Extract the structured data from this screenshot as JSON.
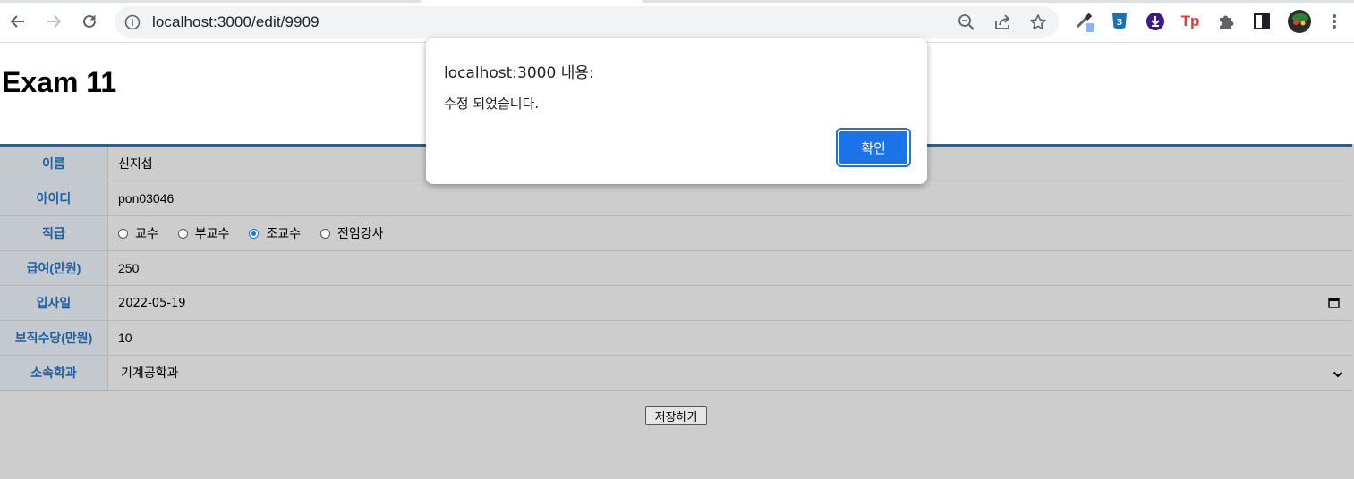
{
  "browser": {
    "url": "localhost:3000/edit/9909",
    "extensions": [
      {
        "name": "eyedropper-extension-icon",
        "color": "#5f6368"
      },
      {
        "name": "css-extension-icon",
        "color": "#1572b6"
      },
      {
        "name": "download-extension-icon",
        "color": "#3d1a8f"
      },
      {
        "name": "tp-extension-icon",
        "label": "Tp",
        "color": "#e53935"
      },
      {
        "name": "puzzle-extensions-icon",
        "color": "#5f6368"
      },
      {
        "name": "side-panel-icon",
        "color": "#202124"
      }
    ]
  },
  "page": {
    "title": "Exam 11",
    "accent_color": "#1f5fa3",
    "form": {
      "name_label": "이름",
      "name_value": "신지섭",
      "id_label": "아이디",
      "id_value": "pon03046",
      "position_label": "직급",
      "position_options": [
        "교수",
        "부교수",
        "조교수",
        "전임강사"
      ],
      "position_selected": "조교수",
      "salary_label": "급여(만원)",
      "salary_value": "250",
      "hire_date_label": "입사일",
      "hire_date_value": "2022-05-19",
      "allowance_label": "보직수당(만원)",
      "allowance_value": "10",
      "department_label": "소속학과",
      "department_value": "기계공학과"
    },
    "save_button": "저장하기"
  },
  "alert": {
    "title": "localhost:3000 내용:",
    "message": "수정 되었습니다.",
    "ok_button": "확인",
    "button_color": "#1a73e8"
  }
}
